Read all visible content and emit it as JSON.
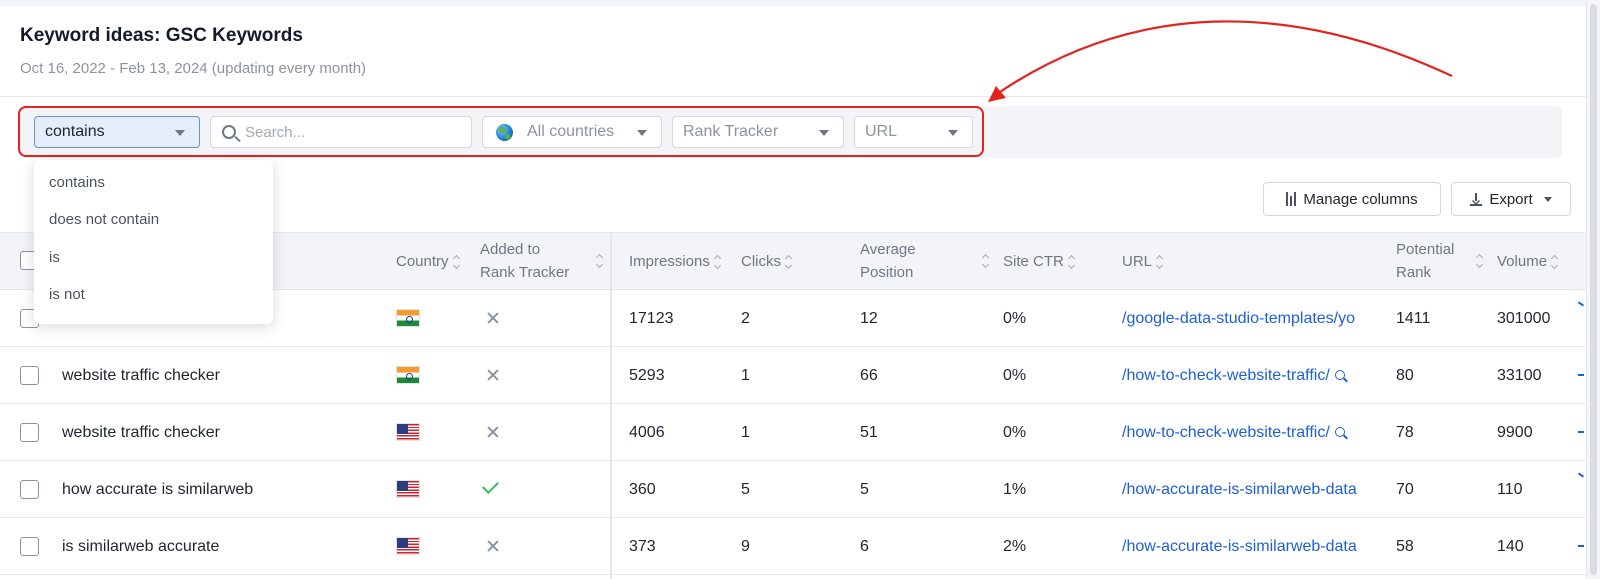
{
  "header": {
    "title": "Keyword ideas: GSC Keywords",
    "subtitle": "Oct 16, 2022 - Feb 13, 2024 (updating every month)"
  },
  "filters": {
    "match_select": {
      "value": "contains",
      "options": [
        "contains",
        "does not contain",
        "is",
        "is not"
      ]
    },
    "search_placeholder": "Search...",
    "country_select": "All countries",
    "rank_tracker_select": "Rank Tracker",
    "url_select": "URL"
  },
  "toolbar": {
    "manage_columns_label": "Manage columns",
    "export_label": "Export"
  },
  "table": {
    "columns": {
      "country": "Country",
      "added_to_rank_tracker_line1": "Added to",
      "added_to_rank_tracker_line2": "Rank Tracker",
      "impressions": "Impressions",
      "clicks": "Clicks",
      "average_position_line1": "Average",
      "average_position_line2": "Position",
      "site_ctr": "Site CTR",
      "url": "URL",
      "potential_rank_line1": "Potential",
      "potential_rank_line2": "Rank",
      "volume": "Volume"
    },
    "rows": [
      {
        "keyword": "",
        "country_flag": "flag-india",
        "in_rank_tracker": false,
        "impressions": "17123",
        "clicks": "2",
        "avg_position": "12",
        "site_ctr": "0%",
        "url": "/google-data-studio-templates/yo",
        "url_has_search_icon": false,
        "potential_rank": "1411",
        "volume": "301000"
      },
      {
        "keyword": "website traffic checker",
        "country_flag": "flag-india",
        "in_rank_tracker": false,
        "impressions": "5293",
        "clicks": "1",
        "avg_position": "66",
        "site_ctr": "0%",
        "url": "/how-to-check-website-traffic/",
        "url_has_search_icon": true,
        "potential_rank": "80",
        "volume": "33100"
      },
      {
        "keyword": "website traffic checker",
        "country_flag": "flag-usa",
        "in_rank_tracker": false,
        "impressions": "4006",
        "clicks": "1",
        "avg_position": "51",
        "site_ctr": "0%",
        "url": "/how-to-check-website-traffic/",
        "url_has_search_icon": true,
        "potential_rank": "78",
        "volume": "9900"
      },
      {
        "keyword": "how accurate is similarweb",
        "country_flag": "flag-usa",
        "in_rank_tracker": true,
        "impressions": "360",
        "clicks": "5",
        "avg_position": "5",
        "site_ctr": "1%",
        "url": "/how-accurate-is-similarweb-data",
        "url_has_search_icon": false,
        "potential_rank": "70",
        "volume": "110"
      },
      {
        "keyword": "is similarweb accurate",
        "country_flag": "flag-usa",
        "in_rank_tracker": false,
        "impressions": "373",
        "clicks": "9",
        "avg_position": "6",
        "site_ctr": "2%",
        "url": "/how-accurate-is-similarweb-data",
        "url_has_search_icon": false,
        "potential_rank": "58",
        "volume": "140"
      }
    ]
  },
  "colors": {
    "annotation": "#e3231e",
    "link": "#1d5fd6",
    "check": "#3cbf5a"
  }
}
